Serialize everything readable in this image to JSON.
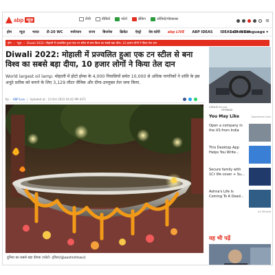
{
  "site": {
    "logo_text": "abp",
    "logo_badge": "न्यूज़",
    "top_links": [
      {
        "label": "टीवी",
        "icon": "tv-icon"
      },
      {
        "label": "वीडियो",
        "icon": "video-icon"
      },
      {
        "label": "फोटो",
        "icon": "photo-icon"
      },
      {
        "label": "ब्रेकिंग",
        "icon": "breaking-icon"
      },
      {
        "label": "ऑडियो/पॉडकास्ट",
        "icon": "podcast-icon"
      }
    ],
    "brand_color": "#e22d1f"
  },
  "nav": {
    "items": [
      "होम",
      "न्यूज़",
      "भारत",
      "टी-20 WC",
      "मनोरंजन",
      "राज्य",
      "बिजनेस",
      "क्रिकेट",
      "ऐस्ट्रो",
      "वेब स्टोरी",
      "abp LIVE",
      "ABP IDEAS",
      "IDEAS OF INDIA"
    ],
    "language_label": "Select Language"
  },
  "breadcrumb": [
    "होम",
    "न्यूज़",
    "Diwali 2022: मोहाली में प्रज्वलित हुआ एक टन स्टील से बना विश्व का सबसे बड़ा दीया, 10 हजार लोगों ने किया तेल दान"
  ],
  "article": {
    "headline": "Diwali 2022: मोहाली में प्रज्वलित हुआ एक टन स्टील से बना विश्व का सबसे बड़ा दीया, 10 हजार लोगों ने किया तेल दान",
    "summary": "World largest oil lamp: मोहाली में होटो होम्स के 4,000 निवासियों समेत 10,000 से अधिक नागरिकों ने शांति के इस अनूठे प्रतीक को बनाने के लिए 3,129 लीटर जैविक और दीया-उपयुक्त तेल जमा किया.",
    "byline_prefix": "By :",
    "author": "ABP Live",
    "separator": "|",
    "updated": "Updated at : 23 Oct 2022 04:42 PM (IST)",
    "caption": "दुनिया का सबसे बड़ा दीपक (फोटो- ट्विटर/@aashishkaul)"
  },
  "sidebar": {
    "ad_label": "VENUE N Line",
    "ad_brand": "HYUNDAI",
    "may_like_title": "You May Like",
    "sponsored_label": "Sponsored Links",
    "may_like_items": [
      {
        "text": "Open a company in the US from India",
        "color": "#7f8b97"
      },
      {
        "text": "This Desktop App Helps You Write...",
        "color": "#3a7fd6"
      },
      {
        "text": "Secure family with 1Cr life cover + Su...",
        "color": "#203a6b"
      },
      {
        "text": "Ashna's Life Is Coming To A Dead...",
        "color": "#2f5d86"
      }
    ],
    "taboola_label": "by Taboola",
    "read_also_title": "यह भी पढ़ें"
  }
}
